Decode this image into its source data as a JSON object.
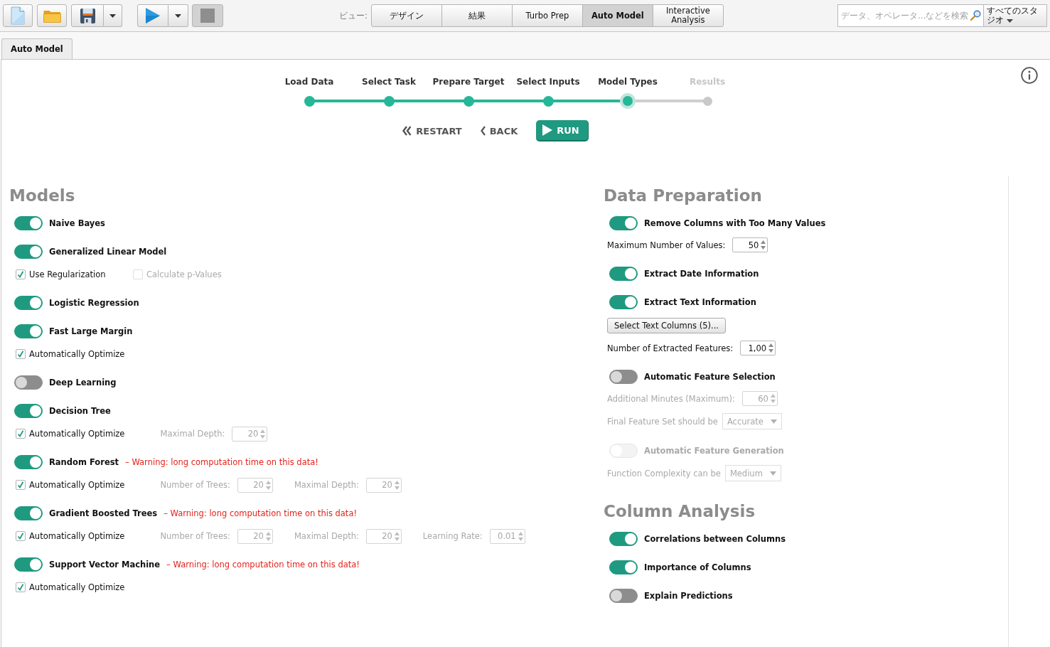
{
  "toolbar": {
    "stop": {
      "disabled": true
    },
    "view_label": "ビュー:",
    "views": [
      {
        "label": "デザイン",
        "selected": false
      },
      {
        "label": "結果",
        "selected": false
      },
      {
        "label": "Turbo Prep",
        "selected": false
      },
      {
        "label": "Auto Model",
        "selected": true
      },
      {
        "label": "Interactive Analysis",
        "selected": false
      }
    ],
    "search": {
      "placeholder": "データ、オペレータ...などを検索"
    },
    "studio_menu": "すべてのスタジオ"
  },
  "tabs": [
    {
      "label": "Auto Model",
      "selected": true
    }
  ],
  "wizard": {
    "steps": [
      {
        "label": "Load Data",
        "completed": true,
        "selected": false
      },
      {
        "label": "Select Task",
        "completed": true,
        "selected": false
      },
      {
        "label": "Prepare Target",
        "completed": true,
        "selected": false
      },
      {
        "label": "Select Inputs",
        "completed": true,
        "selected": false
      },
      {
        "label": "Model Types",
        "completed": false,
        "selected": true
      },
      {
        "label": "Results",
        "completed": false,
        "selected": false
      }
    ],
    "buttons": [
      {
        "label": "RESTART",
        "kind": "restart"
      },
      {
        "label": "BACK",
        "kind": "back"
      },
      {
        "label": "RUN",
        "kind": "run"
      }
    ]
  },
  "models": {
    "title": "Models",
    "items": [
      {
        "name": "Naive Bayes",
        "on": true
      },
      {
        "name": "Generalized Linear Model",
        "on": true,
        "options": [
          {
            "kind": "checkbox",
            "label": "Use Regularization",
            "checked": true,
            "disabled": false
          },
          {
            "kind": "checkbox",
            "label": "Calculate p-Values",
            "checked": false,
            "disabled": true
          }
        ]
      },
      {
        "name": "Logistic Regression",
        "on": true
      },
      {
        "name": "Fast Large Margin",
        "on": true,
        "options": [
          {
            "kind": "checkbox",
            "label": "Automatically Optimize",
            "checked": true,
            "disabled": false
          }
        ]
      },
      {
        "name": "Deep Learning",
        "on": false
      },
      {
        "name": "Decision Tree",
        "on": true,
        "options": [
          {
            "kind": "checkbox",
            "label": "Automatically Optimize",
            "checked": true,
            "disabled": false
          },
          {
            "kind": "spinner",
            "label": "Maximal Depth:",
            "value": "20",
            "disabled": true
          }
        ]
      },
      {
        "name": "Random Forest",
        "on": true,
        "warning": "– Warning: long computation time on this data!",
        "options": [
          {
            "kind": "checkbox",
            "label": "Automatically Optimize",
            "checked": true,
            "disabled": false
          },
          {
            "kind": "spinner",
            "label": "Number of Trees:",
            "value": "20",
            "disabled": true
          },
          {
            "kind": "spinner",
            "label": "Maximal Depth:",
            "value": "20",
            "disabled": true
          }
        ]
      },
      {
        "name": "Gradient Boosted Trees",
        "on": true,
        "warning": "– Warning: long computation time on this data!",
        "options": [
          {
            "kind": "checkbox",
            "label": "Automatically Optimize",
            "checked": true,
            "disabled": false
          },
          {
            "kind": "spinner",
            "label": "Number of Trees:",
            "value": "20",
            "disabled": true
          },
          {
            "kind": "spinner",
            "label": "Maximal Depth:",
            "value": "20",
            "disabled": true
          },
          {
            "kind": "spinner",
            "label": "Learning Rate:",
            "value": "0.01",
            "disabled": true
          }
        ]
      },
      {
        "name": "Support Vector Machine",
        "on": true,
        "warning": "– Warning: long computation time on this data!",
        "options": [
          {
            "kind": "checkbox",
            "label": "Automatically Optimize",
            "checked": true,
            "disabled": false
          }
        ]
      }
    ]
  },
  "data_preparation": {
    "title": "Data Preparation",
    "items": [
      {
        "kind": "toggle",
        "label": "Remove Columns with Too Many Values",
        "on": true,
        "disabled": false
      },
      {
        "kind": "spinner",
        "label": "Maximum Number of Values:",
        "value": "50",
        "disabled": false
      },
      {
        "kind": "toggle",
        "label": "Extract Date Information",
        "on": true,
        "disabled": false
      },
      {
        "kind": "toggle",
        "label": "Extract Text Information",
        "on": true,
        "disabled": false
      },
      {
        "kind": "button",
        "label": "Select Text Columns (5)..."
      },
      {
        "kind": "spinner",
        "label": "Number of Extracted Features:",
        "value": "1,00",
        "disabled": false
      },
      {
        "kind": "toggle",
        "label": "Automatic Feature Selection",
        "on": false,
        "disabled": false
      },
      {
        "kind": "spinner",
        "label": "Additional Minutes (Maximum):",
        "value": "60",
        "disabled": true
      },
      {
        "kind": "dropdown",
        "label": "Final Feature Set should be",
        "value": "Accurate",
        "disabled": true
      },
      {
        "kind": "toggle",
        "label": "Automatic Feature Generation",
        "on": false,
        "disabled": true
      },
      {
        "kind": "dropdown",
        "label": "Function Complexity can be",
        "value": "Medium",
        "disabled": true
      }
    ]
  },
  "column_analysis": {
    "title": "Column Analysis",
    "items": [
      {
        "kind": "toggle",
        "label": "Correlations between Columns",
        "on": true,
        "disabled": false
      },
      {
        "kind": "toggle",
        "label": "Importance of Columns",
        "on": true,
        "disabled": false
      },
      {
        "kind": "toggle",
        "label": "Explain Predictions",
        "on": false,
        "disabled": false
      }
    ]
  }
}
